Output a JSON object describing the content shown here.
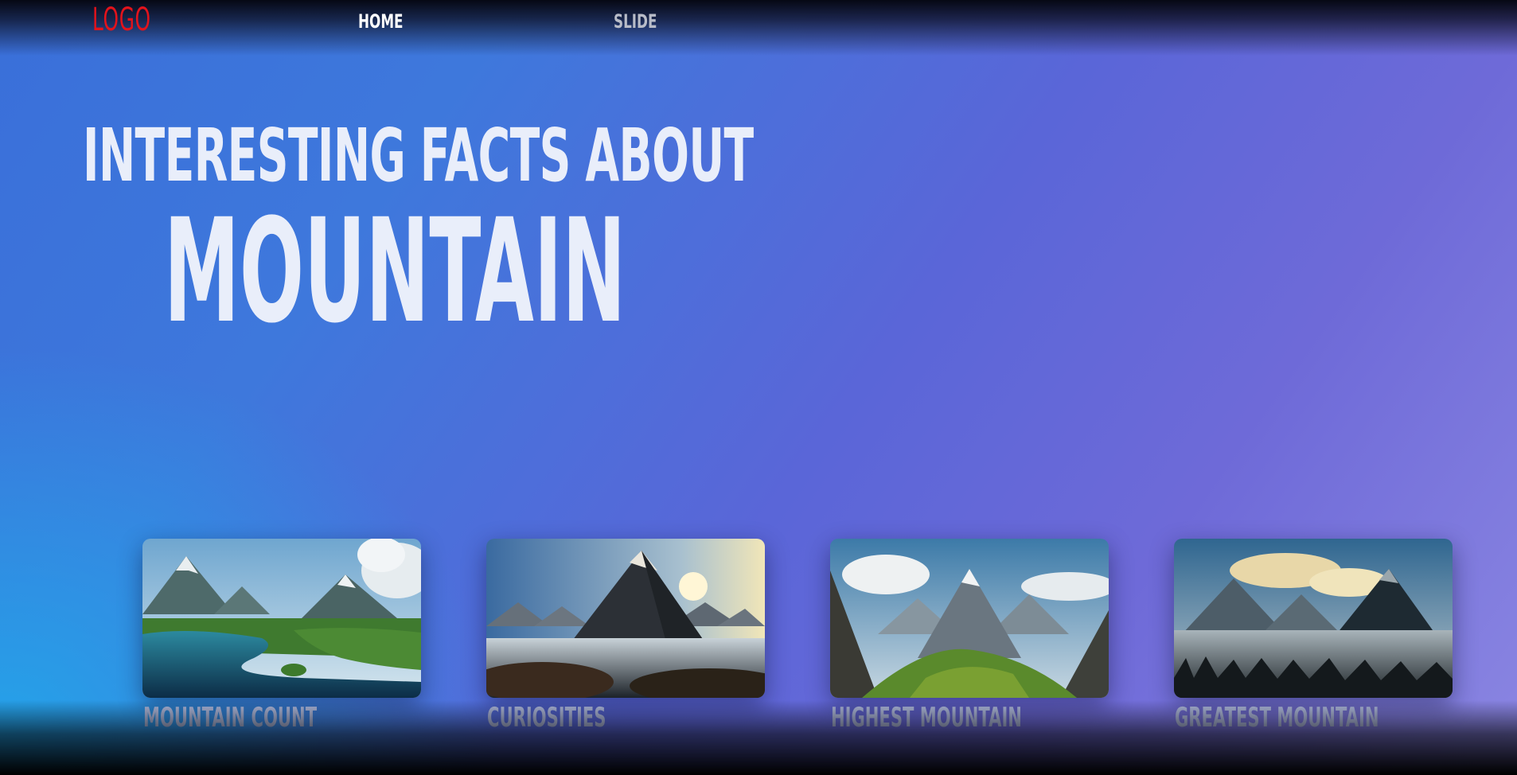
{
  "nav": {
    "logo": "LOGO",
    "links": [
      {
        "label": "HOME",
        "active": true
      },
      {
        "label": "SLIDE",
        "active": false
      }
    ]
  },
  "hero": {
    "line1": "INTERESTING FACTS ABOUT",
    "line2": "MOUNTAIN"
  },
  "cards": [
    {
      "label": "MOUNTAIN COUNT",
      "image": "mountain-lake-landscape-image"
    },
    {
      "label": "CURIOSITIES",
      "image": "misty-mountain-peak-image"
    },
    {
      "label": "HIGHEST MOUNTAIN",
      "image": "valley-peak-landscape-image"
    },
    {
      "label": "GREATEST MOUNTAIN",
      "image": "foggy-mountain-range-image"
    }
  ],
  "colors": {
    "logo": "#e3131b",
    "nav_active": "#ffffff",
    "nav_inactive": "#b8bcc8",
    "hero_text": "#e9eefa",
    "card_label": "#a9b3d6",
    "bg_start": "#2aa6e8",
    "bg_end": "#8b86e2"
  }
}
